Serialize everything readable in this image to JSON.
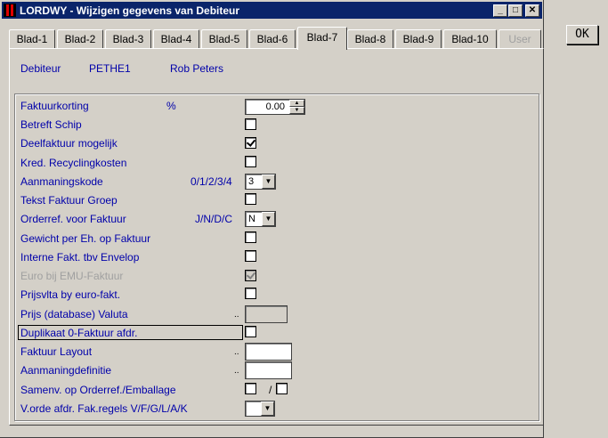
{
  "window": {
    "title": "LORDWY - Wijzigen gegevens van Debiteur"
  },
  "title_buttons": {
    "minimize": "_",
    "maximize": "□",
    "close": "✕"
  },
  "tabs": [
    "Blad-1",
    "Blad-2",
    "Blad-3",
    "Blad-4",
    "Blad-5",
    "Blad-6",
    "Blad-7",
    "Blad-8",
    "Blad-9",
    "Blad-10",
    "User"
  ],
  "active_tab": "Blad-7",
  "disabled_tab": "User",
  "header": {
    "label": "Debiteur",
    "code": "PETHE1",
    "name": "Rob Peters"
  },
  "fields": {
    "faktuurkorting": {
      "label": "Faktuurkorting",
      "unit": "%",
      "value": "0.00"
    },
    "betreft_schip": {
      "label": "Betreft Schip",
      "checked": false
    },
    "deelfaktuur": {
      "label": "Deelfaktuur mogelijk",
      "checked": true
    },
    "kred_recycling": {
      "label": "Kred. Recyclingkosten",
      "checked": false
    },
    "aanmaningskode": {
      "label": "Aanmaningskode",
      "hint": "0/1/2/3/4",
      "value": "3"
    },
    "tekst_faktuur_groep": {
      "label": "Tekst Faktuur Groep",
      "checked": false
    },
    "orderref": {
      "label": "Orderref. voor Faktuur",
      "hint": "J/N/D/C",
      "value": "N"
    },
    "gewicht": {
      "label": "Gewicht per Eh. op Faktuur",
      "checked": false
    },
    "interne_fakt": {
      "label": "Interne Fakt. tbv Envelop",
      "checked": false
    },
    "euro_emu": {
      "label": "Euro bij EMU-Faktuur",
      "checked": true,
      "disabled": true
    },
    "prijsvlta": {
      "label": "Prijsvlta by euro-fakt.",
      "checked": false
    },
    "prijs_valuta": {
      "label": "Prijs (database) Valuta",
      "dots": "..",
      "value": ""
    },
    "duplikaat": {
      "label": "Duplikaat 0-Faktuur afdr.",
      "checked": false
    },
    "faktuur_layout": {
      "label": "Faktuur Layout",
      "dots": "..",
      "value": ""
    },
    "aanmaningdefinitie": {
      "label": "Aanmaningdefinitie",
      "dots": "..",
      "value": ""
    },
    "samenv": {
      "label": "Samenv. op Orderref./Emballage",
      "separator": "/",
      "checked1": false,
      "checked2": false
    },
    "vorde": {
      "label": "V.orde afdr. Fak.regels V/F/G/L/A/K",
      "value": ""
    }
  },
  "ok_button": "OK"
}
